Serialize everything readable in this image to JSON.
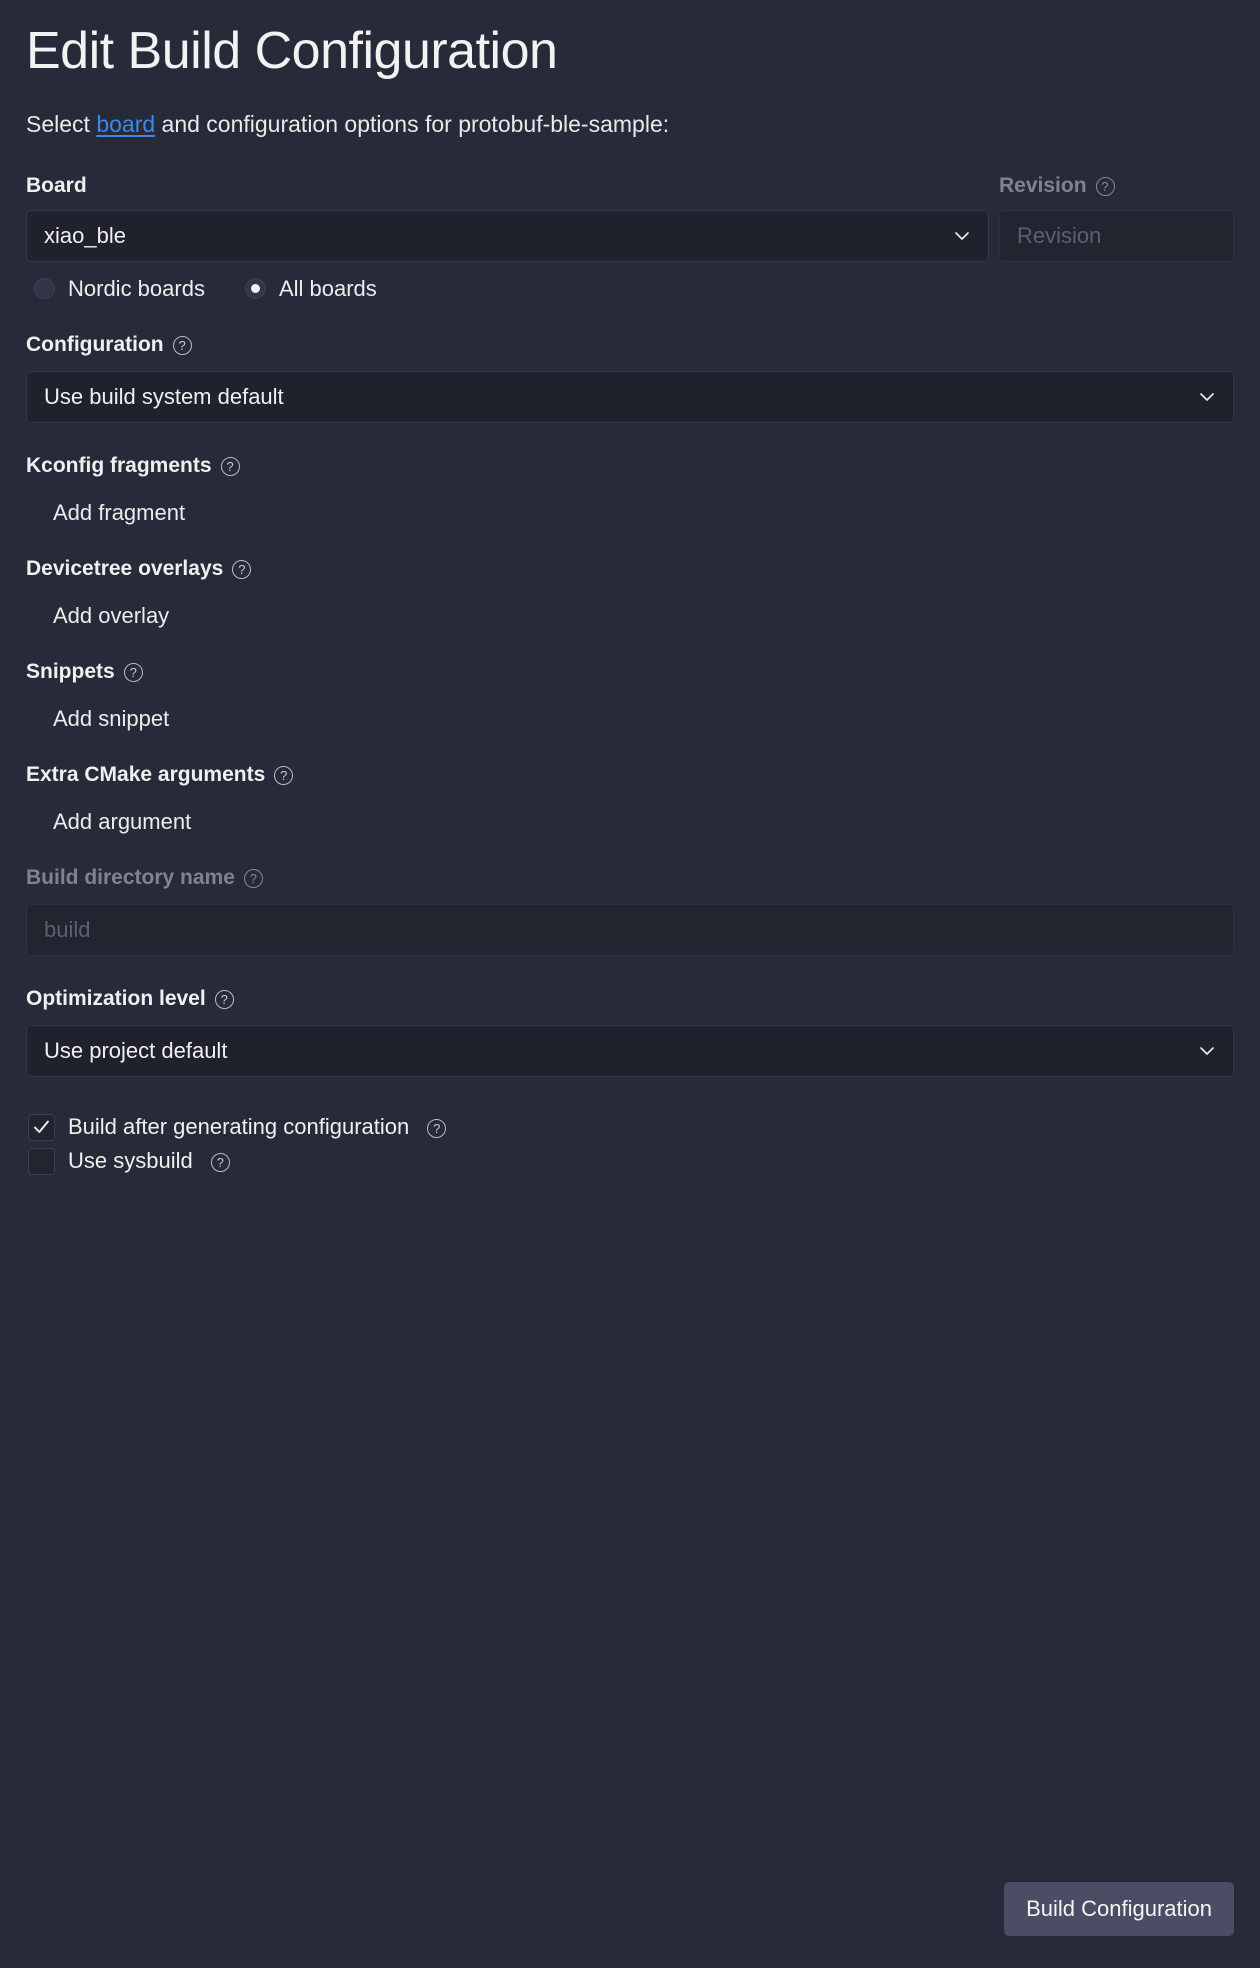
{
  "header": {
    "title": "Edit Build Configuration",
    "subtitle_before": "Select ",
    "subtitle_link": "board",
    "subtitle_after": " and configuration options for protobuf-ble-sample:"
  },
  "board": {
    "label": "Board",
    "value": "xiao_ble",
    "revision_label": "Revision",
    "revision_placeholder": "Revision",
    "radios": [
      {
        "label": "Nordic boards",
        "selected": false
      },
      {
        "label": "All boards",
        "selected": true
      }
    ]
  },
  "configuration": {
    "label": "Configuration",
    "value": "Use build system default"
  },
  "kconfig": {
    "label": "Kconfig fragments",
    "add_label": "Add fragment"
  },
  "devicetree": {
    "label": "Devicetree overlays",
    "add_label": "Add overlay"
  },
  "snippets": {
    "label": "Snippets",
    "add_label": "Add snippet"
  },
  "cmake": {
    "label": "Extra CMake arguments",
    "add_label": "Add argument"
  },
  "build_dir": {
    "label": "Build directory name",
    "placeholder": "build"
  },
  "optimization": {
    "label": "Optimization level",
    "value": "Use project default"
  },
  "checkboxes": [
    {
      "label": "Build after generating configuration",
      "checked": true
    },
    {
      "label": "Use sysbuild",
      "checked": false
    }
  ],
  "footer": {
    "submit_label": "Build Configuration"
  },
  "icons": {
    "help": "?"
  },
  "colors": {
    "background": "#272a38",
    "input_background": "#1f212c",
    "link": "#3b89e8",
    "button": "#4a4d63",
    "text": "#f0f0f0",
    "muted_text": "#80838f"
  }
}
